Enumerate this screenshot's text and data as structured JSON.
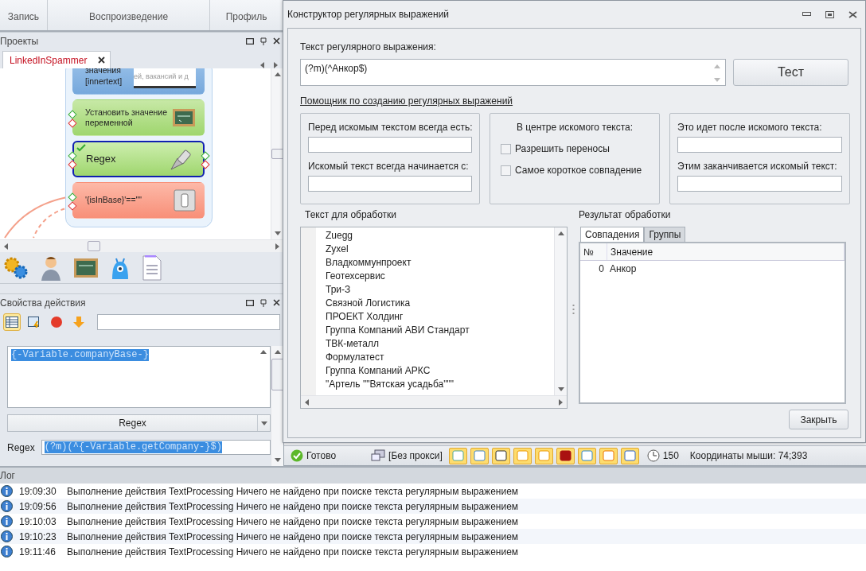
{
  "ribbon_tabs": [
    {
      "label": "Запись"
    },
    {
      "label": "Воспроизведение"
    },
    {
      "label": "Профиль"
    }
  ],
  "projects": {
    "title": "Проекты",
    "tab": {
      "label": "LinkedInSpammer",
      "selected": true
    },
    "nodes": [
      {
        "kind": "getter",
        "lines": [
          "значения",
          "[innertext]"
        ],
        "thumbnail_text": "ей, вакансий и д",
        "selected": false
      },
      {
        "kind": "setter",
        "lines": [
          "Установить значение",
          "переменной"
        ],
        "selected": false
      },
      {
        "kind": "regex",
        "lines": [
          "Regex"
        ],
        "selected": true
      },
      {
        "kind": "condition",
        "lines": [
          "'{isInBase}'==\"\""
        ],
        "selected": false
      }
    ]
  },
  "properties": {
    "title": "Свойства действия",
    "text_value": "{-Variable.companyBase-}",
    "action_select": "Regex",
    "field_label": "Regex",
    "field_value": "(?m)(^{-Variable.getCompany-}$)"
  },
  "dialog": {
    "title": "Конструктор регулярных выражений",
    "regex_label": "Текст регулярного выражения:",
    "regex_value": "(?m)(^Анкор$)",
    "test_button": "Тест",
    "helper_link": "Помощник по созданию регулярных выражений",
    "before_group": {
      "labels": [
        "Перед искомым текстом всегда есть:",
        "Искомый текст всегда начинается с:"
      ]
    },
    "center_group": {
      "title": "В центре искомого текста:",
      "options": [
        {
          "label": "Разрешить переносы",
          "checked": false
        },
        {
          "label": "Самое короткое совпадение",
          "checked": false
        }
      ]
    },
    "after_group": {
      "labels": [
        "Это идет после искомого текста:",
        "Этим заканчивается искомый текст:"
      ]
    },
    "input_label": "Текст для обработки",
    "input_lines": [
      "Zuegg",
      "Zyxel",
      "Владкоммунпроект",
      "Геотехсервис",
      "Три-З",
      "Связной Логистика",
      "ПРОЕКТ Холдинг",
      "Группа Компаний АВИ Стандарт",
      "ТВК-металл",
      "Формулатест",
      "Группа Компаний АРКС",
      "\"Артель \"\"Вятская усадьба\"\"\""
    ],
    "result_label": "Результат обработки",
    "result_tabs": [
      {
        "label": "Совпадения",
        "selected": true
      },
      {
        "label": "Группы",
        "selected": false
      }
    ],
    "result_columns": [
      "№",
      "Значение"
    ],
    "result_rows": [
      {
        "index": "0",
        "value": "Анкор"
      }
    ],
    "close_button": "Закрыть"
  },
  "status_bar": {
    "status": "Готово",
    "proxy": "[Без прокси]",
    "counter": "150",
    "mouse": "Координаты мыши: 74;393"
  },
  "log": {
    "title": "Лог",
    "entries": [
      {
        "time": "19:09:30",
        "message": "Выполнение действия TextProcessing Ничего не найдено при поиске текста регулярным выражением"
      },
      {
        "time": "19:09:56",
        "message": "Выполнение действия TextProcessing Ничего не найдено при поиске текста регулярным выражением"
      },
      {
        "time": "19:10:03",
        "message": "Выполнение действия TextProcessing Ничего не найдено при поиске текста регулярным выражением"
      },
      {
        "time": "19:10:23",
        "message": "Выполнение действия TextProcessing Ничего не найдено при поиске текста регулярным выражением"
      },
      {
        "time": "19:11:46",
        "message": "Выполнение действия TextProcessing Ничего не найдено при поиске текста регулярным выражением"
      }
    ]
  }
}
